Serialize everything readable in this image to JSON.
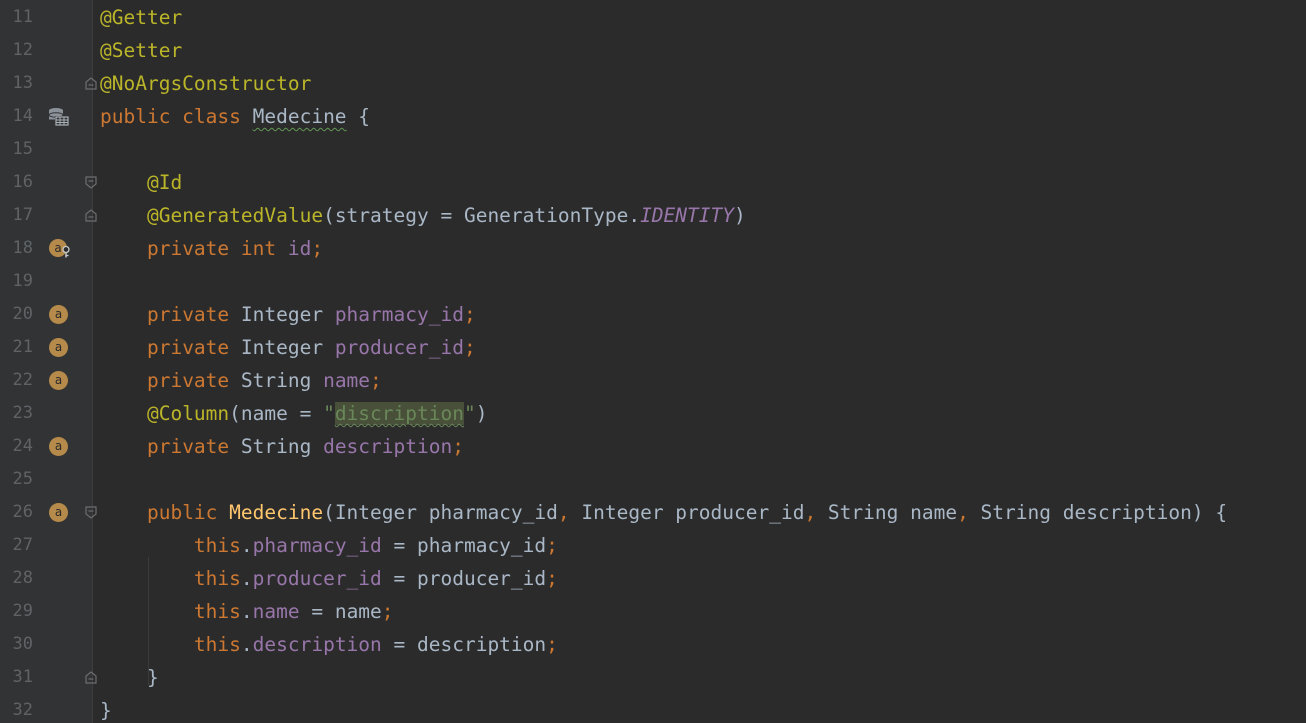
{
  "editor": {
    "lines": [
      {
        "num": "11",
        "tokens": [
          {
            "t": "@Getter",
            "c": "ann"
          }
        ]
      },
      {
        "num": "12",
        "tokens": [
          {
            "t": "@Setter",
            "c": "ann"
          }
        ]
      },
      {
        "num": "13",
        "tokens": [
          {
            "t": "@NoArgsConstructor",
            "c": "ann"
          }
        ]
      },
      {
        "num": "14",
        "tokens": [
          {
            "t": "public class ",
            "c": "kw"
          },
          {
            "t": "Medecine",
            "c": "txt cls-ul"
          },
          {
            "t": " {",
            "c": "txt"
          }
        ]
      },
      {
        "num": "15",
        "tokens": []
      },
      {
        "num": "16",
        "tokens": [
          {
            "t": "    "
          },
          {
            "t": "@Id",
            "c": "ann"
          }
        ]
      },
      {
        "num": "17",
        "tokens": [
          {
            "t": "    "
          },
          {
            "t": "@GeneratedValue",
            "c": "ann"
          },
          {
            "t": "(strategy = GenerationType.",
            "c": "txt"
          },
          {
            "t": "IDENTITY",
            "c": "cst"
          },
          {
            "t": ")",
            "c": "txt"
          }
        ]
      },
      {
        "num": "18",
        "tokens": [
          {
            "t": "    "
          },
          {
            "t": "private int ",
            "c": "kw"
          },
          {
            "t": "id",
            "c": "fld"
          },
          {
            "t": ";",
            "c": "kw"
          }
        ]
      },
      {
        "num": "19",
        "tokens": []
      },
      {
        "num": "20",
        "tokens": [
          {
            "t": "    "
          },
          {
            "t": "private ",
            "c": "kw"
          },
          {
            "t": "Integer ",
            "c": "txt"
          },
          {
            "t": "pharmacy_id",
            "c": "fld"
          },
          {
            "t": ";",
            "c": "kw"
          }
        ]
      },
      {
        "num": "21",
        "tokens": [
          {
            "t": "    "
          },
          {
            "t": "private ",
            "c": "kw"
          },
          {
            "t": "Integer ",
            "c": "txt"
          },
          {
            "t": "producer_id",
            "c": "fld"
          },
          {
            "t": ";",
            "c": "kw"
          }
        ]
      },
      {
        "num": "22",
        "tokens": [
          {
            "t": "    "
          },
          {
            "t": "private ",
            "c": "kw"
          },
          {
            "t": "String ",
            "c": "txt"
          },
          {
            "t": "name",
            "c": "fld"
          },
          {
            "t": ";",
            "c": "kw"
          }
        ]
      },
      {
        "num": "23",
        "tokens": [
          {
            "t": "    "
          },
          {
            "t": "@Column",
            "c": "ann"
          },
          {
            "t": "(name = ",
            "c": "txt"
          },
          {
            "t": "\"",
            "c": "str"
          },
          {
            "t": "discription",
            "c": "str-hl"
          },
          {
            "t": "\"",
            "c": "str"
          },
          {
            "t": ")",
            "c": "txt"
          }
        ]
      },
      {
        "num": "24",
        "tokens": [
          {
            "t": "    "
          },
          {
            "t": "private ",
            "c": "kw"
          },
          {
            "t": "String ",
            "c": "txt"
          },
          {
            "t": "description",
            "c": "fld"
          },
          {
            "t": ";",
            "c": "kw"
          }
        ]
      },
      {
        "num": "25",
        "tokens": []
      },
      {
        "num": "26",
        "tokens": [
          {
            "t": "    "
          },
          {
            "t": "public ",
            "c": "kw"
          },
          {
            "t": "Medecine",
            "c": "fn"
          },
          {
            "t": "(Integer pharmacy_id",
            "c": "txt"
          },
          {
            "t": ", ",
            "c": "kw"
          },
          {
            "t": "Integer producer_id",
            "c": "txt"
          },
          {
            "t": ", ",
            "c": "kw"
          },
          {
            "t": "String name",
            "c": "txt"
          },
          {
            "t": ", ",
            "c": "kw"
          },
          {
            "t": "String description) {",
            "c": "txt"
          }
        ]
      },
      {
        "num": "27",
        "tokens": [
          {
            "t": "        "
          },
          {
            "t": "this",
            "c": "kw"
          },
          {
            "t": ".",
            "c": "txt"
          },
          {
            "t": "pharmacy_id",
            "c": "fld"
          },
          {
            "t": " = pharmacy_id",
            "c": "txt"
          },
          {
            "t": ";",
            "c": "kw"
          }
        ]
      },
      {
        "num": "28",
        "tokens": [
          {
            "t": "        "
          },
          {
            "t": "this",
            "c": "kw"
          },
          {
            "t": ".",
            "c": "txt"
          },
          {
            "t": "producer_id",
            "c": "fld"
          },
          {
            "t": " = producer_id",
            "c": "txt"
          },
          {
            "t": ";",
            "c": "kw"
          }
        ]
      },
      {
        "num": "29",
        "tokens": [
          {
            "t": "        "
          },
          {
            "t": "this",
            "c": "kw"
          },
          {
            "t": ".",
            "c": "txt"
          },
          {
            "t": "name",
            "c": "fld"
          },
          {
            "t": " = name",
            "c": "txt"
          },
          {
            "t": ";",
            "c": "kw"
          }
        ]
      },
      {
        "num": "30",
        "tokens": [
          {
            "t": "        "
          },
          {
            "t": "this",
            "c": "kw"
          },
          {
            "t": ".",
            "c": "txt"
          },
          {
            "t": "description",
            "c": "fld"
          },
          {
            "t": " = description",
            "c": "txt"
          },
          {
            "t": ";",
            "c": "kw"
          }
        ]
      },
      {
        "num": "31",
        "tokens": [
          {
            "t": "    "
          },
          {
            "t": "}",
            "c": "txt"
          }
        ]
      },
      {
        "num": "32",
        "tokens": [
          {
            "t": "}",
            "c": "txt"
          }
        ]
      }
    ],
    "gutter_markers": {
      "14": "database-table-icon",
      "18": "field-key-icon",
      "20": "field-icon",
      "21": "field-icon",
      "22": "field-icon",
      "24": "field-icon",
      "26": "field-icon"
    },
    "marker_letter": "a",
    "fold_markers": {
      "13": "fold-end",
      "16": "fold-start",
      "17": "fold-end",
      "26": "fold-start",
      "31": "fold-end"
    }
  },
  "colors": {
    "background": "#2b2b2b",
    "gutter": "#313335",
    "keyword": "#cc7832",
    "annotation": "#bbb529",
    "field": "#9876aa",
    "string": "#6a8759",
    "function": "#ffc66d",
    "text": "#a9b7c6",
    "line_number": "#606366"
  }
}
